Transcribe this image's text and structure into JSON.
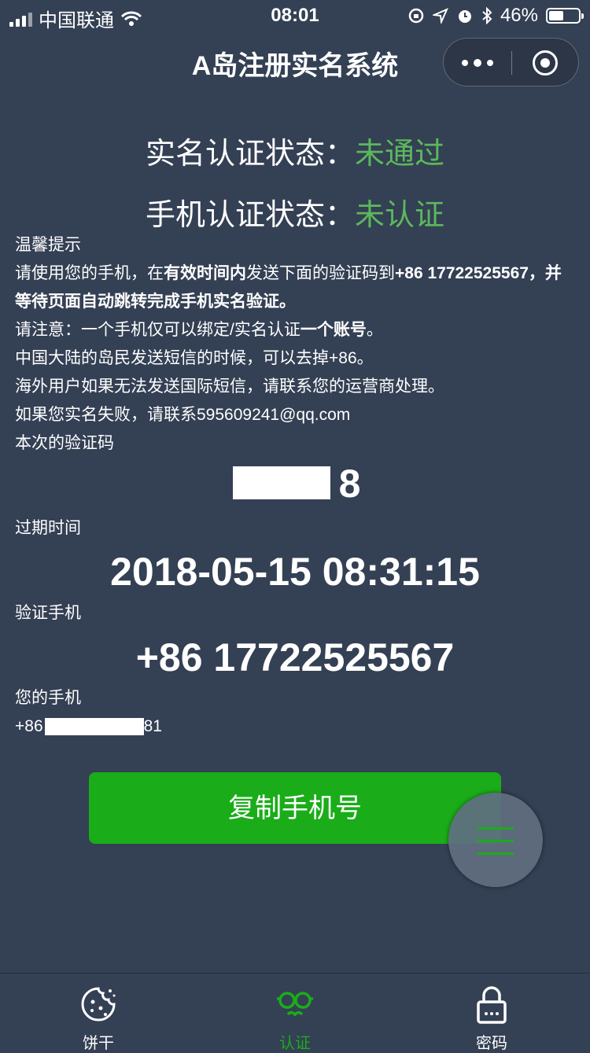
{
  "status_bar": {
    "carrier": "中国联通",
    "time": "08:01",
    "battery": "46%"
  },
  "nav": {
    "title": "A岛注册实名系统"
  },
  "status": {
    "realname_label": "实名认证状态：",
    "realname_value": "未通过",
    "phone_label": "手机认证状态：",
    "phone_value": "未认证"
  },
  "tips": {
    "heading": "温馨提示",
    "line1_a": "请使用您的手机，在",
    "line1_b": "有效时间内",
    "line1_c": "发送下面的验证码到",
    "line1_d": "+86 17722525567，并等待页面自动跳转完成手机实名验证。",
    "line2_a": "请注意：一个手机仅可以绑定/实名认证",
    "line2_b": "一个账号",
    "line2_c": "。",
    "line3": "中国大陆的岛民发送短信的时候，可以去掉+86。",
    "line4": "海外用户如果无法发送国际短信，请联系您的运营商处理。",
    "line5": "如果您实名失败，请联系595609241@qq.com"
  },
  "code": {
    "label": "本次的验证码",
    "value": "8"
  },
  "expire": {
    "label": "过期时间",
    "value": "2018-05-15 08:31:15"
  },
  "verify_phone": {
    "label": "验证手机",
    "value": "+86 17722525567"
  },
  "my_phone": {
    "label": "您的手机",
    "prefix": "+86",
    "suffix": "81"
  },
  "copy_button": "复制手机号",
  "tabs": [
    {
      "label": "饼干",
      "icon": "cookie-icon"
    },
    {
      "label": "认证",
      "icon": "glasses-icon"
    },
    {
      "label": "密码",
      "icon": "lock-icon"
    }
  ],
  "colors": {
    "background": "#344054",
    "accent_green": "#1aad19",
    "status_green": "#5cb85c"
  }
}
